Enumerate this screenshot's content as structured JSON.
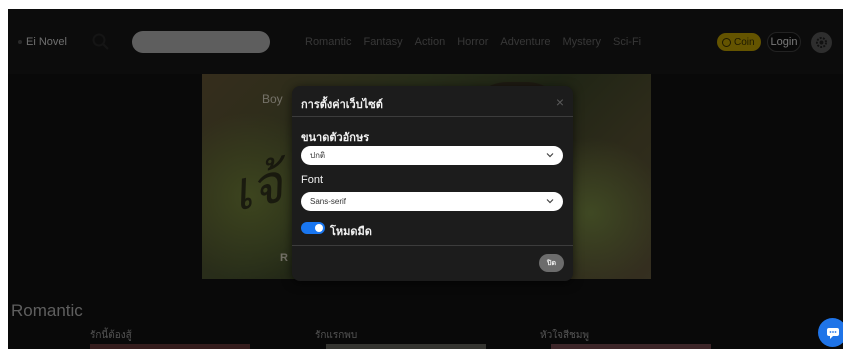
{
  "header": {
    "brand": "Ei Novel",
    "search_placeholder": "",
    "nav": [
      "Romantic",
      "Fantasy",
      "Action",
      "Horror",
      "Adventure",
      "Mystery",
      "Sci-Fi"
    ],
    "coin_label": "Coin",
    "login_label": "Login"
  },
  "banner": {
    "logo_text": "Boy",
    "overlay_text": "R"
  },
  "section": {
    "title": "Romantic",
    "cards": [
      "รักนี้ต้องสู้",
      "รักแรกพบ",
      "หัวใจสีชมพู"
    ]
  },
  "modal": {
    "title": "การตั้งค่าเว็บไซต์",
    "close_icon": "×",
    "font_size_label": "ขนาดตัวอักษร",
    "font_size_value": "ปกติ",
    "font_label": "Font",
    "font_value": "Sans-serif",
    "dark_mode_label": "โหมดมืด",
    "dark_mode_on": true,
    "close_button": "ปิด"
  },
  "colors": {
    "accent": "#1976f0",
    "coin": "#c9a800",
    "chat": "#1f74e8"
  },
  "icons": [
    "search-icon",
    "gear-icon",
    "close-icon",
    "chevron-down-icon",
    "chat-icon"
  ]
}
